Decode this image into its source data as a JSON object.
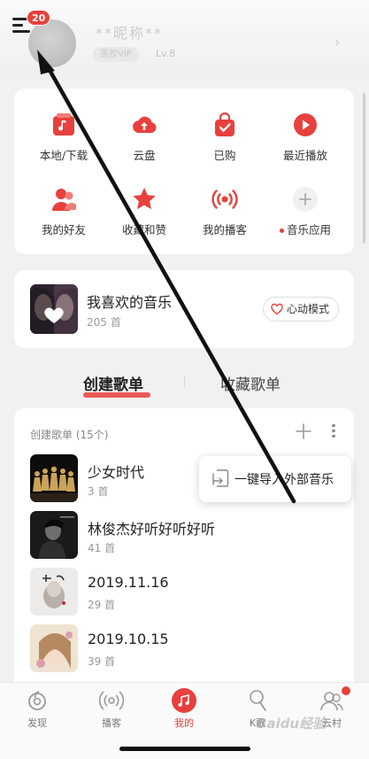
{
  "header": {
    "message_badge": "20",
    "username": "**昵称**",
    "vip_tag": "黑胶VIP",
    "level": "Lv.8"
  },
  "shortcuts": [
    {
      "label": "本地/下载",
      "icon": "download-music-icon"
    },
    {
      "label": "云盘",
      "icon": "cloud-upload-icon"
    },
    {
      "label": "已购",
      "icon": "shopping-bag-check-icon"
    },
    {
      "label": "最近播放",
      "icon": "play-circle-icon"
    },
    {
      "label": "我的好友",
      "icon": "friends-icon"
    },
    {
      "label": "收藏和赞",
      "icon": "star-icon"
    },
    {
      "label": "我的播客",
      "icon": "podcast-icon"
    },
    {
      "label": "音乐应用",
      "icon": "plus-icon"
    }
  ],
  "liked": {
    "title": "我喜欢的音乐",
    "count": "205 首",
    "mode_button": "心动模式"
  },
  "tabs": {
    "created": "创建歌单",
    "collected": "收藏歌单"
  },
  "playlists": {
    "header": "创建歌单 (15个)",
    "items": [
      {
        "name": "少女时代",
        "count": "3 首"
      },
      {
        "name": "林俊杰好听好听好听",
        "count": "41 首"
      },
      {
        "name": "2019.11.16",
        "count": "29 首"
      },
      {
        "name": "2019.10.15",
        "count": "39 首"
      }
    ],
    "import_option": "一键导入外部音乐"
  },
  "bottom_nav": [
    {
      "label": "发现",
      "icon": "netease-logo-icon",
      "active": false
    },
    {
      "label": "播客",
      "icon": "broadcast-icon",
      "active": false
    },
    {
      "label": "我的",
      "icon": "music-note-icon",
      "active": true
    },
    {
      "label": "K歌",
      "icon": "microphone-icon",
      "active": false
    },
    {
      "label": "云村",
      "icon": "community-icon",
      "active": false
    }
  ],
  "watermark": "Baidu经验",
  "colors": {
    "accent": "#e8403c",
    "background": "#f1f1f1",
    "card": "#ffffff"
  }
}
